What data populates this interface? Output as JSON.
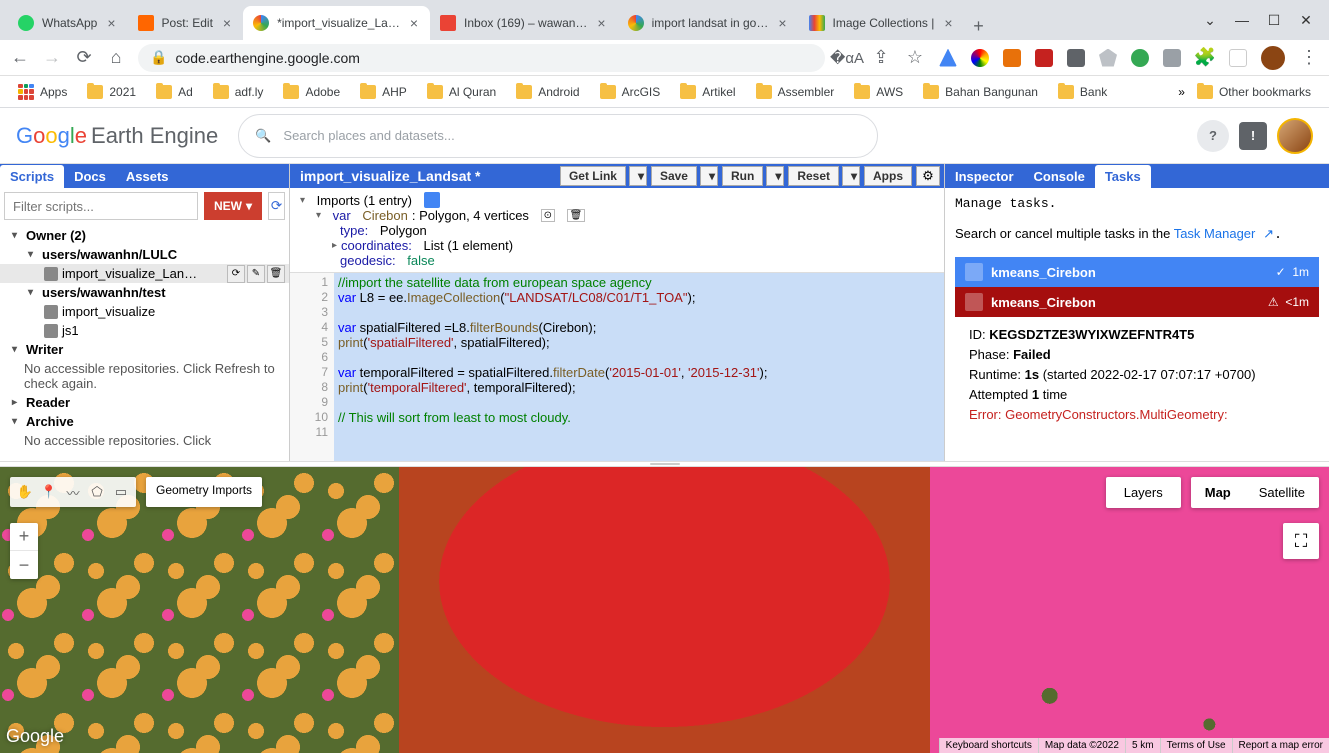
{
  "browser": {
    "tabs": [
      {
        "title": "WhatsApp",
        "favicon": "#25d366"
      },
      {
        "title": "Post: Edit",
        "favicon": "#ff6600"
      },
      {
        "title": "*import_visualize_La…",
        "favicon": "#4285f4",
        "active": true
      },
      {
        "title": "Inbox (169) – wawan…",
        "favicon": "#ea4335"
      },
      {
        "title": "import landsat in go…",
        "favicon": "#4285f4"
      },
      {
        "title": "Image Collections |",
        "favicon": "#4285f4"
      }
    ],
    "url": "code.earthengine.google.com",
    "bookmarks": [
      "2021",
      "Ad",
      "adf.ly",
      "Adobe",
      "AHP",
      "Al Quran",
      "Android",
      "ArcGIS",
      "Artikel",
      "Assembler",
      "AWS",
      "Bahan Bangunan",
      "Bank"
    ],
    "apps_label": "Apps",
    "other_bookmarks": "Other bookmarks",
    "more": "»"
  },
  "gee": {
    "logo_ee": "Earth Engine",
    "search_placeholder": "Search places and datasets...",
    "help": "?",
    "feedback": "!"
  },
  "left": {
    "tabs": [
      "Scripts",
      "Docs",
      "Assets"
    ],
    "filter_placeholder": "Filter scripts...",
    "new_btn": "NEW",
    "tree": {
      "owner": "Owner (2)",
      "repo1": "users/wawanhn/LULC",
      "file1": "import_visualize_Lan…",
      "repo2": "users/wawanhn/test",
      "file2": "import_visualize",
      "file3": "js1",
      "writer": "Writer",
      "writer_note": "No accessible repositories. Click Refresh to check again.",
      "reader": "Reader",
      "archive": "Archive",
      "archive_note": "No accessible repositories. Click"
    }
  },
  "editor": {
    "title": "import_visualize_Landsat *",
    "btns": {
      "getlink": "Get Link",
      "save": "Save",
      "run": "Run",
      "reset": "Reset",
      "apps": "Apps"
    },
    "imports": {
      "header": "Imports (1 entry)",
      "var": "var",
      "name": "Cirebon",
      "type_label": ": Polygon, 4 vertices",
      "type_k": "type:",
      "type_v": "Polygon",
      "coord_k": "coordinates:",
      "coord_v": "List (1 element)",
      "geod_k": "geodesic:",
      "geod_v": "false"
    },
    "code_lines": [
      "1",
      "2",
      "3",
      "4",
      "5",
      "6",
      "7",
      "8",
      "9",
      "10",
      "11"
    ]
  },
  "right": {
    "tabs": [
      "Inspector",
      "Console",
      "Tasks"
    ],
    "manage": "Manage tasks.",
    "search_text": "Search or cancel multiple tasks in the ",
    "tm": "Task Manager",
    "tasks": [
      {
        "name": "kmeans_Cirebon",
        "time": "1m",
        "cls": "blue",
        "status": "✓"
      },
      {
        "name": "kmeans_Cirebon",
        "time": "<1m",
        "cls": "red",
        "status": "⚠"
      }
    ],
    "detail": {
      "id_label": "ID: ",
      "id": "KEGSDZTZE3WYIXWZEFNTR4T5",
      "phase_label": "Phase: ",
      "phase": "Failed",
      "runtime_label": "Runtime: ",
      "runtime": "1s",
      "runtime_extra": " (started 2022-02-17 07:07:17 +0700)",
      "attempt_label": "Attempted ",
      "attempt": "1",
      "attempt_extra": " time",
      "error": "Error: GeometryConstructors.MultiGeometry:"
    }
  },
  "map": {
    "geom_imports": "Geometry Imports",
    "layers": "Layers",
    "map": "Map",
    "satellite": "Satellite",
    "logo": "Google",
    "attr": [
      "Keyboard shortcuts",
      "Map data ©2022",
      "5 km",
      "Terms of Use",
      "Report a map error"
    ]
  }
}
